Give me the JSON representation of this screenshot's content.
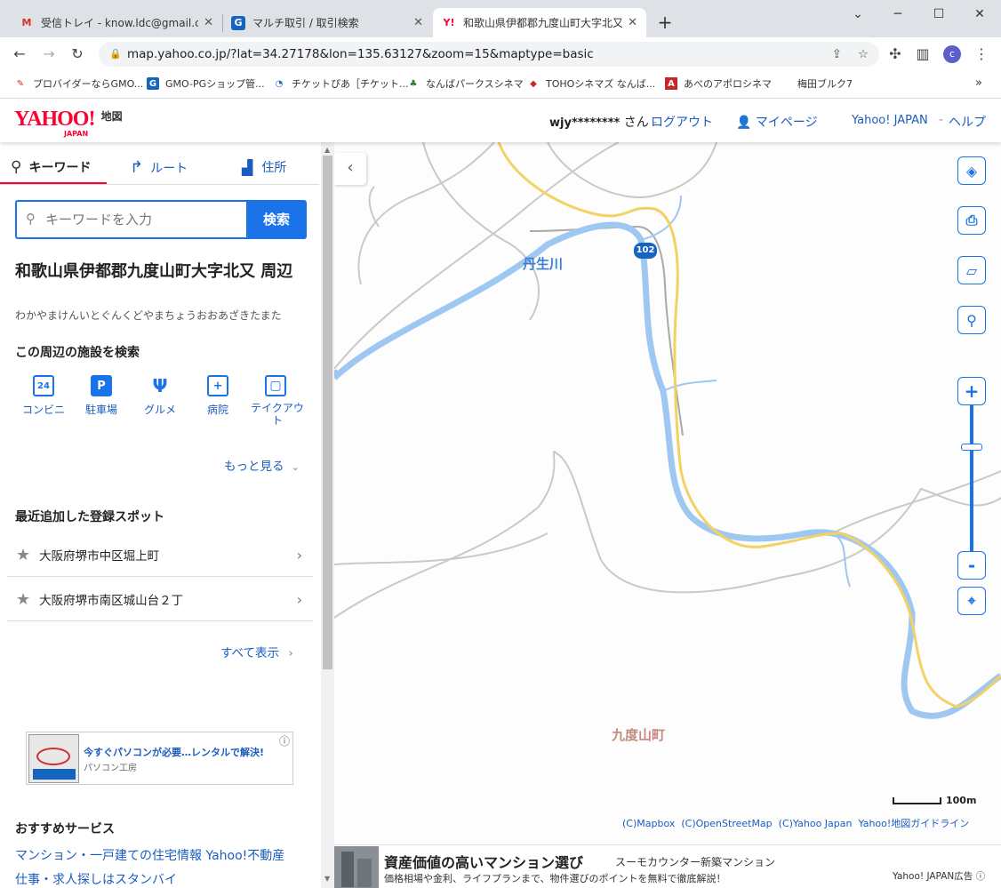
{
  "browser": {
    "tabs": [
      {
        "title": "受信トレイ - know.ldc@gmail.com",
        "icon": "gmail-icon"
      },
      {
        "title": "マルチ取引 / 取引検索",
        "icon": "g-icon"
      },
      {
        "title": "和歌山県伊都郡九度山町大字北又",
        "icon": "yahoo-icon"
      }
    ],
    "url": "map.yahoo.co.jp/?lat=34.27178&lon=135.63127&zoom=15&maptype=basic",
    "profile_initial": "c",
    "bookmarks": [
      "プロバイダーならGMO...",
      "GMO-PGショップ管...",
      "チケットぴあ［チケット...",
      "なんばパークスシネマ",
      "TOHOシネマズ なんば...",
      "あべのアポロシネマ",
      "梅田ブルク7"
    ]
  },
  "header": {
    "logo": "YAHOO!",
    "logo_sub": "JAPAN",
    "logo_label": "地図",
    "user": "wjy********",
    "user_suffix": "さん",
    "logout": "ログアウト",
    "mypage": "マイページ",
    "yahoo_japan": "Yahoo! JAPAN",
    "help": "ヘルプ",
    "dash": "-"
  },
  "sidebar": {
    "tabs": {
      "keyword": "キーワード",
      "route": "ルート",
      "address": "住所"
    },
    "search": {
      "placeholder": "キーワードを入力",
      "button": "検索"
    },
    "location": {
      "title": "和歌山県伊都郡九度山町大字北又 周辺",
      "reading": "わかやまけんいとぐんくどやまちょうおおあざきたまた"
    },
    "nearby_heading": "この周辺の施設を検索",
    "facilities": [
      {
        "label": "コンビニ",
        "icon": "24"
      },
      {
        "label": "駐車場",
        "icon": "P"
      },
      {
        "label": "グルメ",
        "icon": "Ψ"
      },
      {
        "label": "病院",
        "icon": "+"
      },
      {
        "label": "テイクアウト",
        "icon": "▢"
      }
    ],
    "more": "もっと見る",
    "spots_heading": "最近追加した登録スポット",
    "spots": [
      "大阪府堺市中区堀上町",
      "大阪府堺市南区城山台２丁"
    ],
    "show_all": "すべて表示",
    "ad": {
      "title": "今すぐパソコンが必要…レンタルで解決!",
      "sponsor": "パソコン工房"
    },
    "recommended_heading": "おすすめサービス",
    "recommended": [
      "マンション・一戸建ての住宅情報 Yahoo!不動産",
      "仕事・求人探しはスタンバイ"
    ]
  },
  "map": {
    "labels": {
      "river": "丹生川",
      "town": "九度山町",
      "route": "102"
    },
    "scale": "100m",
    "attribution": [
      "(C)Mapbox",
      "(C)OpenStreetMap",
      "(C)Yahoo Japan",
      "Yahoo!地図ガイドライン"
    ],
    "zoom": {
      "plus": "+",
      "minus": "-"
    }
  },
  "bottom_ad": {
    "title": "資産価値の高いマンション選び",
    "sponsor": "スーモカウンター新築マンション",
    "desc": "価格相場や金利、ライフプランまで、物件選びのポイントを無料で徹底解説！",
    "label": "Yahoo! JAPAN広告"
  },
  "colors": {
    "yahoo_red": "#ff0033",
    "link": "#1a5dbf",
    "accent": "#1a73e8",
    "road": "#f3d263",
    "river": "#9ec8f2"
  }
}
